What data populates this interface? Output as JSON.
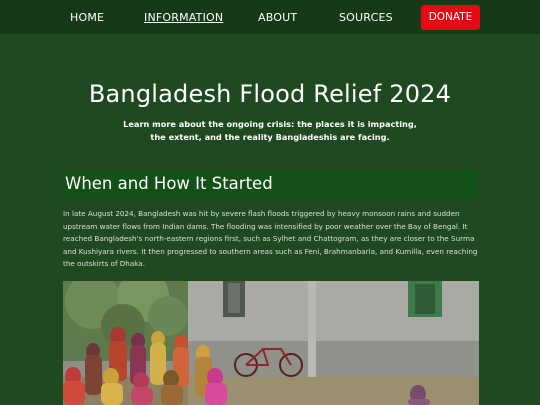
{
  "nav": {
    "items": [
      {
        "label": "HOME"
      },
      {
        "label": "INFORMATION"
      },
      {
        "label": "ABOUT"
      },
      {
        "label": "SOURCES"
      }
    ],
    "donate_label": "DONATE"
  },
  "hero": {
    "title": "Bangladesh Flood Relief 2024",
    "subtitle_line1": "Learn more about the ongoing crisis: the places it is impacting,",
    "subtitle_line2": "the extent, and the reality Bangladeshis are facing."
  },
  "section": {
    "title": "When and How It Started",
    "paragraph": "In late August 2024, Bangladesh was hit by severe flash floods triggered by heavy monsoon rains and sudden upstream water flows from Indian dams. The flooding was intensified by poor weather over the Bay of Bengal. It reached Bangladesh's north-eastern regions first, such as Sylhet and Chattogram, as they are closer to the Surma and Kushiyara rivers. It then progressed to southern areas such as Feni, Brahmanbaria, and Kumilla, even reaching the outskirts of Dhaka."
  },
  "colors": {
    "page_bg": "#1f4a21",
    "nav_bg": "#163a18",
    "section_bar": "#135118",
    "donate": "#e50914"
  }
}
